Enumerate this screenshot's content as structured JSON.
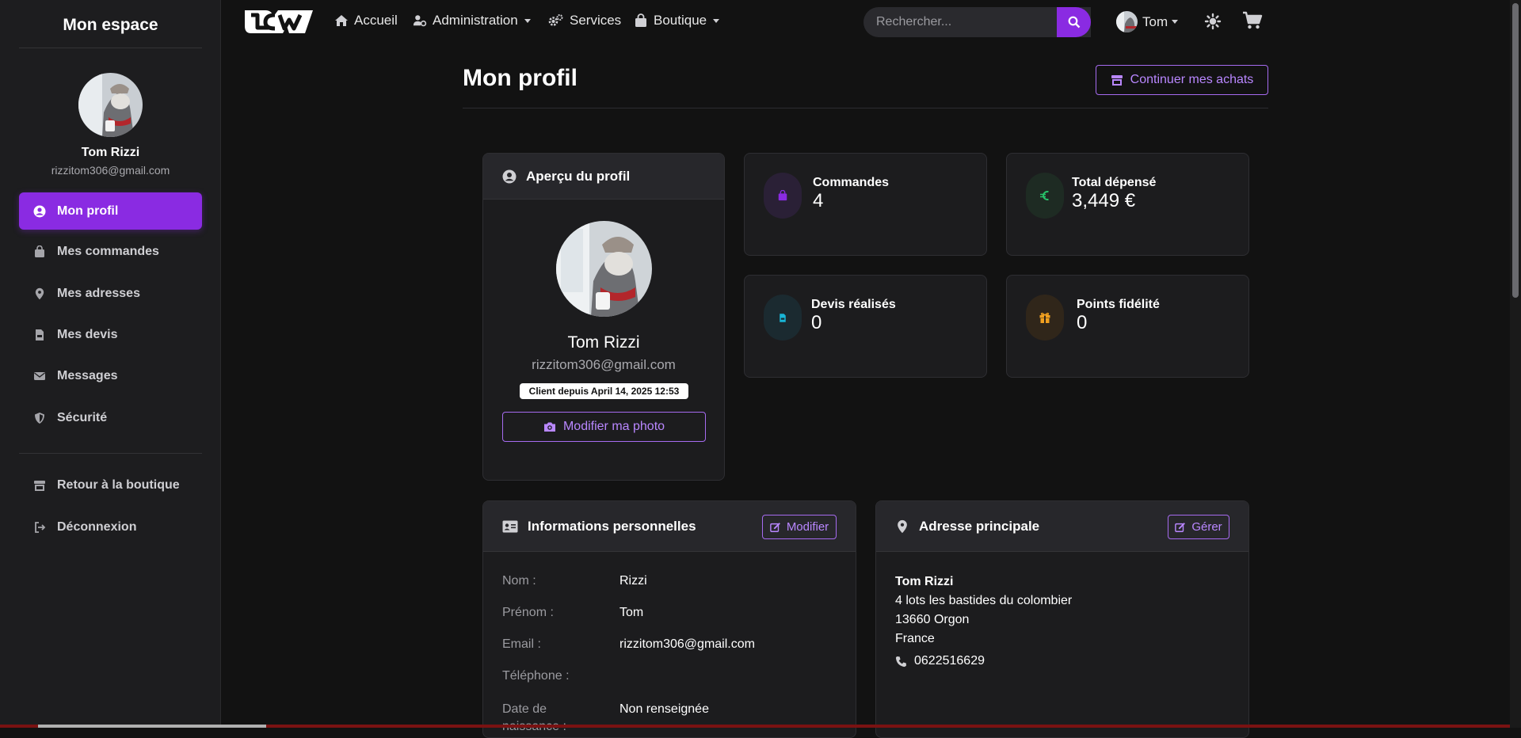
{
  "sidebar": {
    "title": "Mon espace",
    "user": {
      "name": "Tom Rizzi",
      "email": "rizzitom306@gmail.com"
    },
    "items": [
      {
        "label": "Mon profil",
        "icon": "user-circle-icon",
        "active": true
      },
      {
        "label": "Mes commandes",
        "icon": "shopping-bag-icon"
      },
      {
        "label": "Mes adresses",
        "icon": "map-pin-icon"
      },
      {
        "label": "Mes devis",
        "icon": "file-invoice-icon"
      },
      {
        "label": "Messages",
        "icon": "envelope-icon"
      },
      {
        "label": "Sécurité",
        "icon": "shield-icon"
      }
    ],
    "footer_items": [
      {
        "label": "Retour à la boutique",
        "icon": "store-icon"
      },
      {
        "label": "Déconnexion",
        "icon": "sign-out-icon"
      }
    ]
  },
  "nav": {
    "logo": "LCW",
    "items": [
      {
        "label": "Accueil",
        "icon": "home-icon"
      },
      {
        "label": "Administration",
        "icon": "user-cog-icon",
        "dropdown": true
      },
      {
        "label": "Services",
        "icon": "cogs-icon"
      },
      {
        "label": "Boutique",
        "icon": "shopping-bag-icon",
        "dropdown": true
      }
    ],
    "search_placeholder": "Rechercher...",
    "user_label": "Tom"
  },
  "page": {
    "title": "Mon profil",
    "continue_button": "Continuer mes achats"
  },
  "profile_card": {
    "header": "Aperçu du profil",
    "name": "Tom Rizzi",
    "email": "rizzitom306@gmail.com",
    "badge": "Client depuis April 14, 2025 12:53",
    "photo_button": "Modifier ma photo"
  },
  "stats": [
    {
      "label": "Commandes",
      "value": "4",
      "icon": "shopping-bag-icon",
      "color": "#8a2be2",
      "bg": "#2a2036"
    },
    {
      "label": "Total dépensé",
      "value": "3,449 €",
      "icon": "euro-icon",
      "color": "#27c46a",
      "bg": "#1e2b23"
    },
    {
      "label": "Devis réalisés",
      "value": "0",
      "icon": "file-invoice-icon",
      "color": "#19b5d6",
      "bg": "#1b2a30"
    },
    {
      "label": "Points fidélité",
      "value": "0",
      "icon": "gift-icon",
      "color": "#f0a020",
      "bg": "#30261a"
    }
  ],
  "personal_info": {
    "header": "Informations personnelles",
    "edit_button": "Modifier",
    "rows": [
      {
        "label": "Nom :",
        "value": "Rizzi"
      },
      {
        "label": "Prénom :",
        "value": "Tom"
      },
      {
        "label": "Email :",
        "value": "rizzitom306@gmail.com"
      },
      {
        "label": "Téléphone :",
        "value": ""
      },
      {
        "label": "Date de naissance :",
        "value": "Non renseignée"
      }
    ]
  },
  "address": {
    "header": "Adresse principale",
    "manage_button": "Gérer",
    "name": "Tom Rizzi",
    "line1": "4 lots les bastides du colombier",
    "line2": "13660 Orgon",
    "country": "France",
    "phone": "0622516629"
  }
}
